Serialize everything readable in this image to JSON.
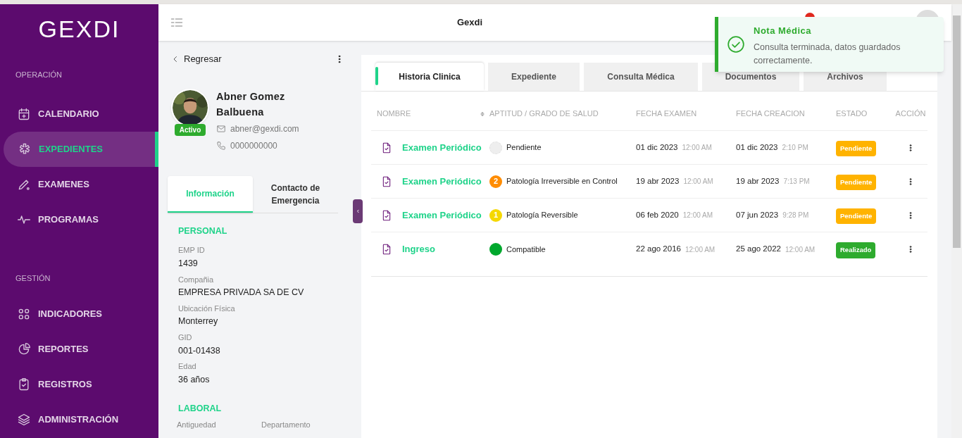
{
  "sidebar": {
    "logo": "GEXDI",
    "sections": [
      {
        "title": "OPERACIÓN",
        "items": [
          {
            "label": "CALENDARIO",
            "selected": false
          },
          {
            "label": "EXPEDIENTES",
            "selected": true
          },
          {
            "label": "EXAMENES",
            "selected": false
          },
          {
            "label": "PROGRAMAS",
            "selected": false
          }
        ]
      },
      {
        "title": "GESTIÓN",
        "items": [
          {
            "label": "INDICADORES",
            "selected": false
          },
          {
            "label": "REPORTES",
            "selected": false
          },
          {
            "label": "REGISTROS",
            "selected": false
          },
          {
            "label": "ADMINISTRACIÓN",
            "selected": false
          }
        ]
      }
    ]
  },
  "header": {
    "title": "Gexdi"
  },
  "toast": {
    "title": "Nota Médica",
    "message": "Consulta terminada, datos guardados correctamente."
  },
  "profile": {
    "back": "Regresar",
    "name": "Abner Gomez Balbuena",
    "status": "Activo",
    "email": "abner@gexdi.com",
    "phone": "0000000000",
    "tabs": [
      {
        "label": "Información",
        "selected": true
      },
      {
        "label": "Contacto de Emergencia",
        "selected": false
      }
    ],
    "sections": [
      {
        "title": "PERSONAL",
        "fields": [
          {
            "label": "EMP ID",
            "value": "1439"
          },
          {
            "label": "Compañia",
            "value": "EMPRESA PRIVADA SA DE CV"
          },
          {
            "label": "Ubicación Física",
            "value": "Monterrey"
          },
          {
            "label": "GID",
            "value": "001-01438"
          },
          {
            "label": "Edad",
            "value": "36 años"
          }
        ]
      },
      {
        "title": "LABORAL",
        "labels": [
          "Antiguedad",
          "Departamento"
        ]
      }
    ]
  },
  "tabs": [
    {
      "label": "Historia Clinica",
      "selected": true
    },
    {
      "label": "Expediente",
      "selected": false
    },
    {
      "label": "Consulta Médica",
      "selected": false
    },
    {
      "label": "Documentos",
      "selected": false
    },
    {
      "label": "Archivos",
      "selected": false
    }
  ],
  "table": {
    "columns": [
      "NOMBRE",
      "APTITUD / GRADO DE SALUD",
      "FECHA EXAMEN",
      "FECHA CREACION",
      "ESTADO",
      "ACCIÓN"
    ],
    "rows": [
      {
        "name": "Examen Periódico",
        "aptitude": {
          "label": "Pendiente",
          "color": "#eeeeee"
        },
        "exam_date": "01 dic 2023",
        "exam_time": "12:00 AM",
        "created_date": "01 dic 2023",
        "created_time": "2:10 PM",
        "status": {
          "label": "Pendiente",
          "color": "#ffb300"
        }
      },
      {
        "name": "Examen Periódico",
        "aptitude": {
          "label": "Patología Irreversible en Control",
          "grade": "2",
          "color": "#ff8c00"
        },
        "exam_date": "19 abr 2023",
        "exam_time": "12:00 AM",
        "created_date": "19 abr 2023",
        "created_time": "7:13 PM",
        "status": {
          "label": "Pendiente",
          "color": "#ffb300"
        }
      },
      {
        "name": "Examen Periódico",
        "aptitude": {
          "label": "Patología Reversible",
          "grade": "1",
          "color": "#f5d800"
        },
        "exam_date": "06 feb 2020",
        "exam_time": "12:00 AM",
        "created_date": "07 jun 2023",
        "created_time": "9:28 PM",
        "status": {
          "label": "Pendiente",
          "color": "#ffb300"
        }
      },
      {
        "name": "Ingreso",
        "aptitude": {
          "label": "Compatible",
          "color": "#00a82d"
        },
        "exam_date": "22 ago 2016",
        "exam_time": "12:00 AM",
        "created_date": "25 ago 2022",
        "created_time": "12:00 AM",
        "status": {
          "label": "Realizado",
          "color": "#2eab2e"
        }
      }
    ]
  }
}
